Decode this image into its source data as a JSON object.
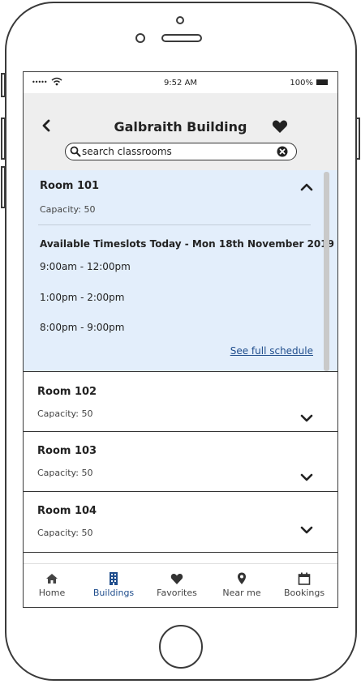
{
  "status_bar": {
    "signal": "•••••",
    "time": "9:52 AM",
    "battery": "100%"
  },
  "header": {
    "title": "Galbraith Building"
  },
  "search": {
    "placeholder": "search classrooms"
  },
  "rooms": [
    {
      "name": "Room 101",
      "capacity": "Capacity: 50",
      "expanded": true,
      "timeslots_heading": "Available Timeslots Today - Mon 18th November 2019",
      "timeslots": [
        "9:00am - 12:00pm",
        "1:00pm - 2:00pm",
        "8:00pm - 9:00pm"
      ],
      "schedule_link": "See full schedule"
    },
    {
      "name": "Room 102",
      "capacity": "Capacity: 50",
      "expanded": false
    },
    {
      "name": "Room 103",
      "capacity": "Capacity: 50",
      "expanded": false
    },
    {
      "name": "Room 104",
      "capacity": "Capacity: 50",
      "expanded": false
    }
  ],
  "tabs": [
    {
      "label": "Home",
      "icon": "home-icon"
    },
    {
      "label": "Buildings",
      "icon": "building-icon",
      "active": true
    },
    {
      "label": "Favorites",
      "icon": "heart-icon"
    },
    {
      "label": "Near me",
      "icon": "map-pin-icon"
    },
    {
      "label": "Bookings",
      "icon": "calendar-icon"
    }
  ],
  "colors": {
    "accent": "#1f4d8c",
    "expanded_bg": "#e3eefb",
    "header_bg": "#eeeeee"
  }
}
